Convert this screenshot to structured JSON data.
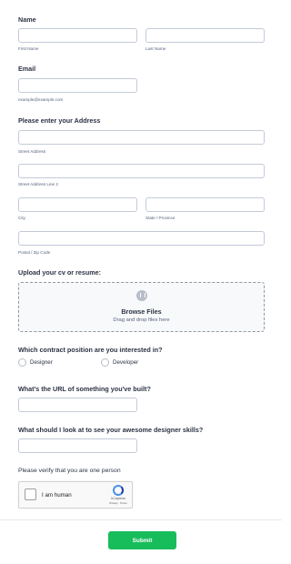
{
  "name_section": {
    "label": "Name",
    "first_sublabel": "First Name",
    "last_sublabel": "Last Name",
    "first_value": "",
    "last_value": ""
  },
  "email_section": {
    "label": "Email",
    "sublabel": "example@example.com",
    "value": ""
  },
  "address_section": {
    "label": "Please enter your Address",
    "street_sublabel": "Street Address",
    "street2_sublabel": "Street Address Line 2",
    "city_sublabel": "City",
    "state_sublabel": "State / Province",
    "zip_sublabel": "Postal / Zip Code"
  },
  "upload_section": {
    "label": "Upload your cv or resume:",
    "browse_label": "Browse Files",
    "drag_text": "Drag and drop files here",
    "icon": "cloud-upload-icon"
  },
  "position_section": {
    "label": "Which contract position are you interested in?",
    "options": [
      "Designer",
      "Developer"
    ]
  },
  "url_section": {
    "label": "What's the URL of something you've built?",
    "value": ""
  },
  "skills_section": {
    "label": "What should I look at to see your awesome designer skills?",
    "value": ""
  },
  "captcha_section": {
    "label": "Please verify that you are one person",
    "checkbox_text": "I am human",
    "brand": "hCaptcha",
    "terms": "Privacy · Terms"
  },
  "submit": {
    "label": "Submit",
    "color": "#18bd5b"
  }
}
